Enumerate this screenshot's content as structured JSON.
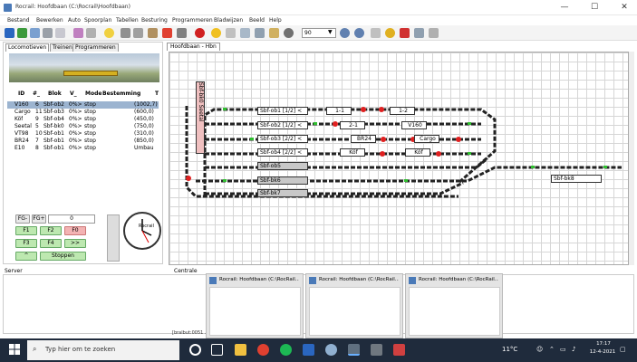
{
  "window": {
    "title": "Rocrail: Hoofdbaan (C:\\Rocrail\\Hoofdbaan)",
    "minimize": "—",
    "maximize": "☐",
    "close": "✕"
  },
  "menu": [
    "Bestand",
    "Bewerken",
    "Auto",
    "Spoorplan",
    "Tabellen",
    "Besturing",
    "Programmeren",
    "Bladwijzen",
    "Beeld",
    "Help"
  ],
  "toolbar": {
    "zoom": "90"
  },
  "left_tabs": [
    "Locomotieven",
    "Treinen",
    "Programmeren"
  ],
  "loco_table": {
    "headers": [
      "ID",
      "#_",
      "Blok",
      "V_",
      "Mode",
      "Bestemming",
      "T"
    ],
    "rows": [
      [
        "V160",
        "6",
        "Sbf-ob2",
        "0%>",
        "stop",
        "(1002,7)"
      ],
      [
        "Cargo",
        "11",
        "Sbf-ob3",
        "0%>",
        "stop",
        "(600,0)"
      ],
      [
        "Köf",
        "9",
        "Sbf-ob4",
        "0%>",
        "stop",
        "(450,0)"
      ],
      [
        "Seetal",
        "5",
        "Sbf-bk0",
        "0%>",
        "stop",
        "(750,0)"
      ],
      [
        "VT98",
        "10",
        "Sbf-ob1",
        "0%>",
        "stop",
        "(310,0)"
      ],
      [
        "BR24",
        "7",
        "Sbf-ob1",
        "0%>",
        "stop",
        "(850,0)"
      ],
      [
        "E10",
        "8",
        "Sbf-ob1",
        "0%>",
        "stop",
        "Umbau"
      ]
    ]
  },
  "throttle": {
    "fg_minus": "FG-",
    "fg_plus": "FG+",
    "speed": "0",
    "f1": "F1",
    "f2": "F2",
    "f0": "F0",
    "f3": "F3",
    "f4": "F4",
    "more": ">>",
    "up": "^",
    "stop": "Stoppen",
    "clock_brand": "Rocrail"
  },
  "plan": {
    "tab": "Hoofdbaan - Hbn",
    "blocks": [
      {
        "label": "Sbf-ob1 [1/2] <"
      },
      {
        "label": "Sbf-ob2 [1/2] <"
      },
      {
        "label": "Sbf-ob3 [2/2] <"
      },
      {
        "label": "Sbf-ob4 [2/2] <"
      },
      {
        "label": "Sbf-ob5"
      },
      {
        "label": "Sbf-bk6"
      },
      {
        "label": "Sbf-bk7"
      },
      {
        "label": "Sbf-bk8"
      },
      {
        "label": "Sbf-bk0 Seetal"
      },
      {
        "label": "1-1"
      },
      {
        "label": "1-2"
      },
      {
        "label": "2-1"
      },
      {
        "label": "V160"
      },
      {
        "label": "BR24"
      },
      {
        "label": "Cargo"
      },
      {
        "label": "Köf"
      },
      {
        "label": "Köf"
      }
    ]
  },
  "bottom": {
    "server": "Server",
    "centrale": "Centrale",
    "status": "[bralbut:0051 ..."
  },
  "thumbs": [
    "Rocrail: Hoofdbaan (C:\\RocRail...",
    "Rocrail: Hoofdbaan (C:\\RocRail...",
    "Rocrail: Hoofdbaan (C:\\RocRail..."
  ],
  "taskbar": {
    "search": "Typ hier om te zoeken",
    "time": "17:17",
    "date": "12-4-2021",
    "temp": "11°C"
  },
  "colors": {
    "accent": "#4a7ab8",
    "taskbar": "#1f2b3c",
    "selected_row": "#9cb4d0",
    "button_green": "#bde8b0",
    "button_red": "#f3b3b3"
  }
}
